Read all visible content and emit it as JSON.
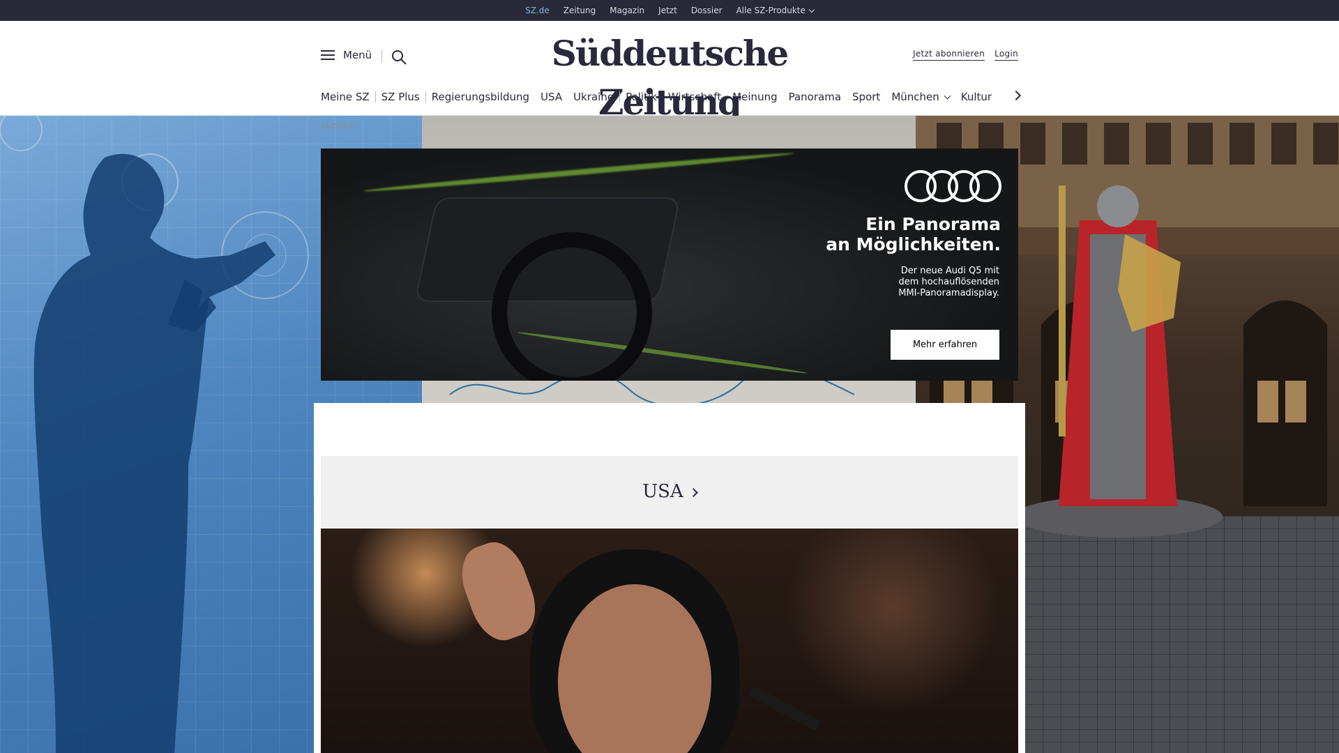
{
  "topbar": {
    "links": [
      "SZ.de",
      "Zeitung",
      "Magazin",
      "Jetzt",
      "Dossier"
    ],
    "products_label": "Alle SZ-Produkte"
  },
  "header": {
    "menu_label": "Menü",
    "logo_text": "Süddeutsche Zeitung",
    "subscribe_label": "Jetzt abonnieren",
    "login_label": "Login"
  },
  "nav": {
    "items": [
      "Meine SZ",
      "SZ Plus",
      "Regierungsbildung",
      "USA",
      "Ukraine",
      "Politik",
      "Wirtschaft",
      "Meinung",
      "Panorama",
      "Sport",
      "München",
      "Kultur"
    ]
  },
  "ad": {
    "anzeige_label": "ANZEIGE",
    "headline_line1": "Ein Panorama",
    "headline_line2": "an Möglichkeiten.",
    "sub_line1": "Der neue Audi Q5 mit",
    "sub_line2": "dem hochauflösenden",
    "sub_line3": "MMI-Panoramadisplay.",
    "cta_label": "Mehr erfahren"
  },
  "section": {
    "title": "USA"
  },
  "colors": {
    "topbar_bg": "#29293a",
    "active_link": "#7fb5d9",
    "text": "#29293a",
    "ad_accent": "#8ed43b"
  }
}
